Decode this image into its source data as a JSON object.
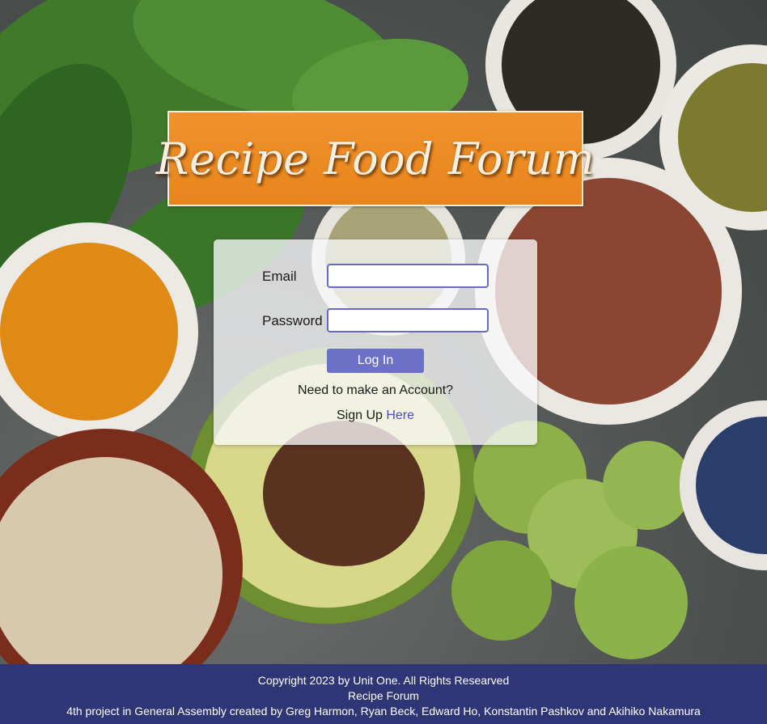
{
  "banner": {
    "title": "Recipe Food Forum"
  },
  "login_form": {
    "email_label": "Email",
    "email_value": "",
    "password_label": "Password",
    "password_value": "",
    "login_button": "Log In",
    "need_account_text": "Need to make an Account?",
    "signup_prefix": "Sign Up",
    "signup_link": "Here"
  },
  "footer": {
    "copyright": "Copyright 2023 by Unit One. All Rights Researved",
    "app_name": "Recipe Forum",
    "credits": "4th project in General Assembly created by Greg Harmon, Ryan Beck, Edward Ho, Konstantin Pashkov and Akihiko Nakamura"
  },
  "colors": {
    "banner_orange": "#ec8a22",
    "accent_purple": "#6c70c6",
    "footer_navy": "#2f3676",
    "link_blue": "#4a4cc9"
  }
}
